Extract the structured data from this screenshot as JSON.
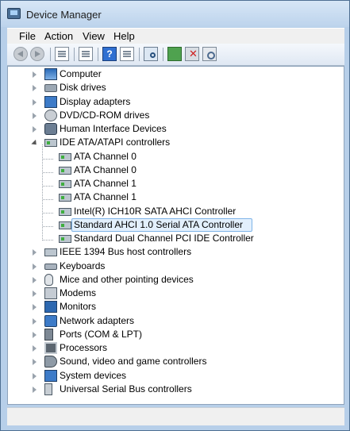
{
  "window": {
    "title": "Device Manager"
  },
  "menu": [
    "File",
    "Action",
    "View",
    "Help"
  ],
  "toolbar": {
    "help_label": "?"
  },
  "tree": {
    "categories_before": [
      {
        "label": "Computer",
        "icon": "computer-icon"
      },
      {
        "label": "Disk drives",
        "icon": "disk-drive-icon"
      },
      {
        "label": "Display adapters",
        "icon": "display-adapter-icon"
      },
      {
        "label": "DVD/CD-ROM drives",
        "icon": "dvd-drive-icon"
      },
      {
        "label": "Human Interface Devices",
        "icon": "hid-icon"
      }
    ],
    "expanded_category": {
      "label": "IDE ATA/ATAPI controllers",
      "icon": "ide-controller-icon",
      "children": [
        "ATA Channel 0",
        "ATA Channel 0",
        "ATA Channel 1",
        "ATA Channel 1",
        "Intel(R) ICH10R SATA AHCI Controller",
        "Standard AHCI 1.0 Serial ATA Controller",
        "Standard Dual Channel PCI IDE Controller"
      ],
      "selected_child": "Standard AHCI 1.0 Serial ATA Controller"
    },
    "categories_after": [
      {
        "label": "IEEE 1394 Bus host controllers",
        "icon": "ieee1394-icon"
      },
      {
        "label": "Keyboards",
        "icon": "keyboard-icon"
      },
      {
        "label": "Mice and other pointing devices",
        "icon": "mouse-icon"
      },
      {
        "label": "Modems",
        "icon": "modem-icon"
      },
      {
        "label": "Monitors",
        "icon": "monitor-icon"
      },
      {
        "label": "Network adapters",
        "icon": "network-adapter-icon"
      },
      {
        "label": "Ports (COM & LPT)",
        "icon": "ports-icon"
      },
      {
        "label": "Processors",
        "icon": "processor-icon"
      },
      {
        "label": "Sound, video and game controllers",
        "icon": "sound-icon"
      },
      {
        "label": "System devices",
        "icon": "system-devices-icon"
      },
      {
        "label": "Universal Serial Bus controllers",
        "icon": "usb-icon"
      }
    ]
  }
}
